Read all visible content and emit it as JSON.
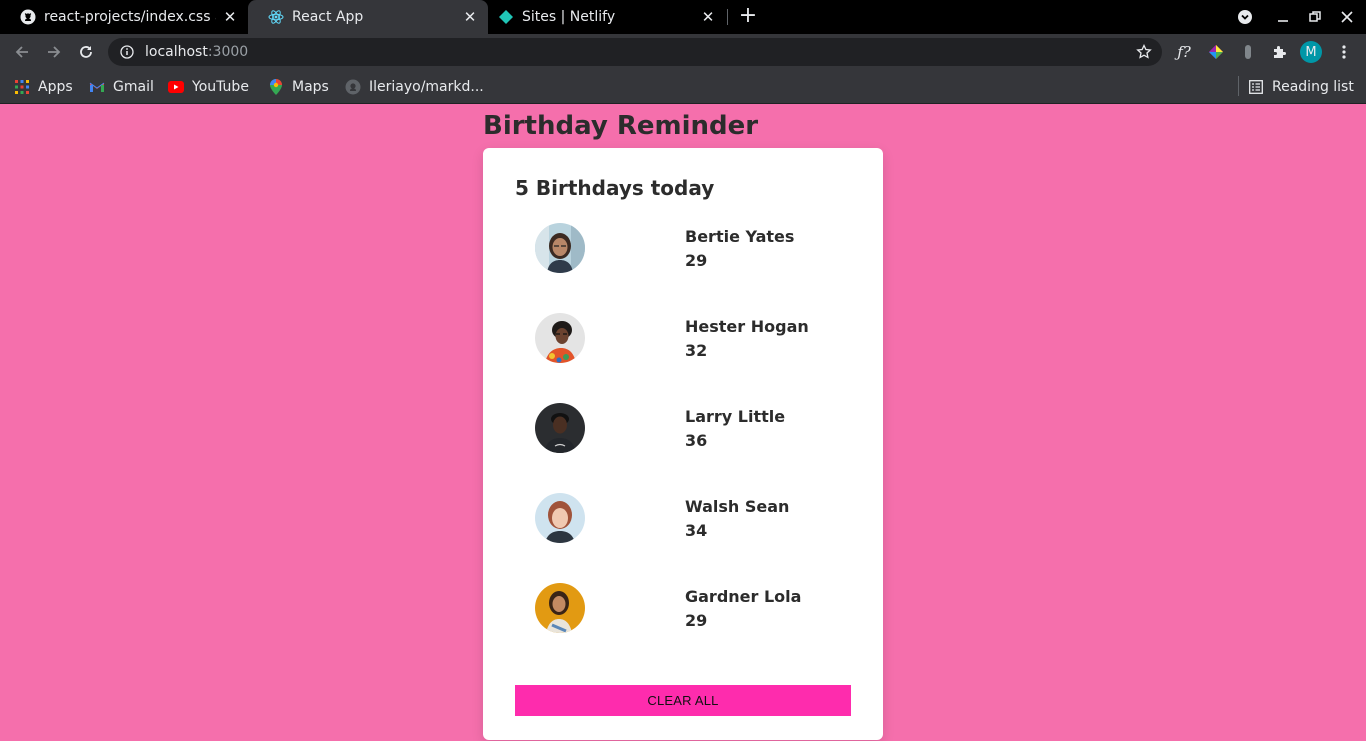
{
  "tabs": [
    {
      "title": "react-projects/index.css a",
      "favicon": "github-icon",
      "active": false
    },
    {
      "title": "React App",
      "favicon": "react-icon",
      "active": true
    },
    {
      "title": "Sites | Netlify",
      "favicon": "netlify-icon",
      "active": false
    }
  ],
  "address_bar": {
    "host": "localhost",
    "port": ":3000"
  },
  "profile": {
    "initial": "M",
    "color": "#0097a7"
  },
  "bookmarks": [
    {
      "label": "Apps",
      "icon": "apps-grid-icon"
    },
    {
      "label": "Gmail",
      "icon": "gmail-icon"
    },
    {
      "label": "YouTube",
      "icon": "youtube-icon"
    },
    {
      "label": "Maps",
      "icon": "maps-icon"
    },
    {
      "label": "Ileriayo/markd...",
      "icon": "github-icon"
    }
  ],
  "reading_list": {
    "label": "Reading list",
    "icon": "reading-list-icon"
  },
  "page": {
    "title": "Birthday Reminder",
    "heading": "5 Birthdays today",
    "people": [
      {
        "name": "Bertie Yates",
        "age": "29"
      },
      {
        "name": "Hester Hogan",
        "age": "32"
      },
      {
        "name": "Larry Little",
        "age": "36"
      },
      {
        "name": "Walsh Sean",
        "age": "34"
      },
      {
        "name": "Gardner Lola",
        "age": "29"
      }
    ],
    "clear_button": "CLEAR ALL"
  },
  "colors": {
    "background": "#f56fac",
    "button": "#fe2cad",
    "card": "#ffffff"
  }
}
